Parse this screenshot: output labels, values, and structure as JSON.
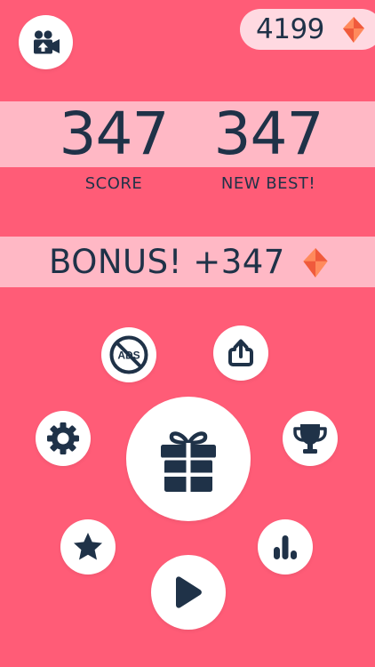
{
  "colors": {
    "background": "#FF5C77",
    "band": "#FFB8C5",
    "button_bg": "#FFFFFF",
    "pill_bg": "#FFD9E1",
    "icon_dark": "#1F3248",
    "gem_top": "#FF8A5C",
    "gem_bottom": "#F05A3C"
  },
  "currency": {
    "gems": "4199",
    "icon": "gem-icon"
  },
  "results": {
    "score": "347",
    "score_label": "SCORE",
    "best": "347",
    "best_label": "NEW BEST!"
  },
  "bonus": {
    "text": "BONUS! +347",
    "icon": "gem-icon"
  },
  "buttons": {
    "camera": "video-camera-icon",
    "no_ads": "no-ads-icon",
    "share": "share-icon",
    "settings": "gear-icon",
    "gift": "gift-icon",
    "trophy": "trophy-icon",
    "rate": "star-icon",
    "leaderboard": "bar-chart-icon",
    "play": "play-icon"
  },
  "no_ads_icon_text": "ADS"
}
